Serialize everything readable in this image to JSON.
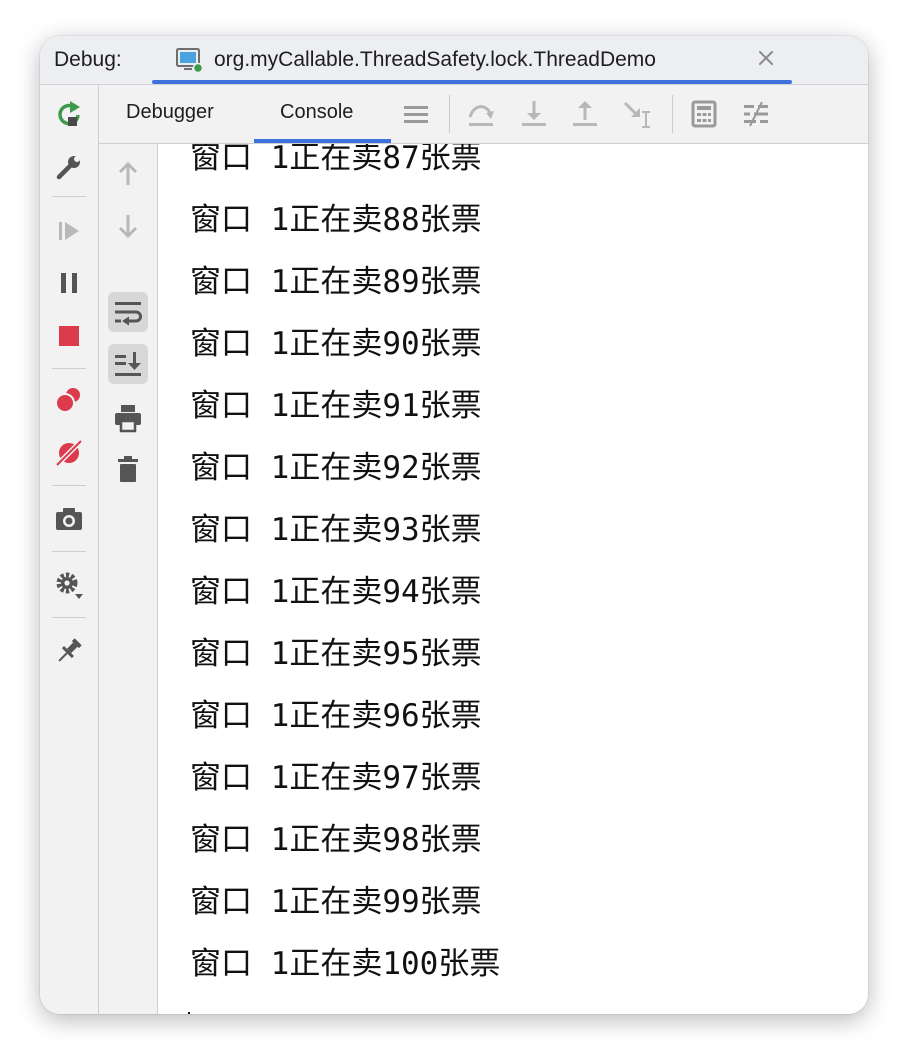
{
  "debug_label": "Debug:",
  "session": {
    "name": "org.myCallable.ThreadSafety.lock.ThreadDemo"
  },
  "tabs": [
    {
      "label": "Debugger"
    },
    {
      "label": "Console"
    }
  ],
  "console": {
    "lines": [
      "窗口 1正在卖87张票",
      "窗口 1正在卖88张票",
      "窗口 1正在卖89张票",
      "窗口 1正在卖90张票",
      "窗口 1正在卖91张票",
      "窗口 1正在卖92张票",
      "窗口 1正在卖93张票",
      "窗口 1正在卖94张票",
      "窗口 1正在卖95张票",
      "窗口 1正在卖96张票",
      "窗口 1正在卖97张票",
      "窗口 1正在卖98张票",
      "窗口 1正在卖99张票",
      "窗口 1正在卖100张票"
    ]
  },
  "colors": {
    "accent": "#3b70dd",
    "rerun": "#3c9a4a",
    "stop": "#db3b4b",
    "icon": "#6e6e6e",
    "icon_disabled": "#b8b8b8"
  },
  "icons": {
    "left_strip": [
      "rerun-icon",
      "settings-wrench-icon",
      "resume-icon",
      "pause-icon",
      "stop-icon",
      "view-breakpoints-icon",
      "mute-breakpoints-icon",
      "camera-icon",
      "gear-icon",
      "pin-icon"
    ],
    "toolbar": [
      "layout-icon",
      "step-over-icon",
      "step-into-icon",
      "step-out-icon",
      "run-to-cursor-icon",
      "evaluate-icon",
      "trace-icon"
    ],
    "gutter": [
      "up-arrow-icon",
      "down-arrow-icon",
      "soft-wrap-icon",
      "scroll-to-end-icon",
      "print-icon",
      "trash-icon"
    ]
  }
}
